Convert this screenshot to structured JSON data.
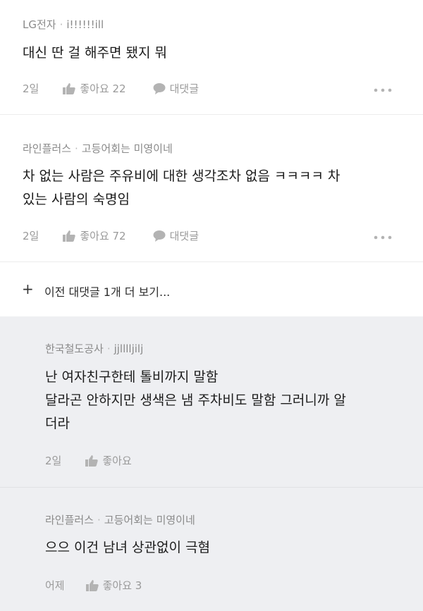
{
  "comments": [
    {
      "author": "LG전자",
      "nickname": "i!!!!!!ill",
      "text_lines": [
        "대신 딴 걸 해주면 됐지 뭐"
      ],
      "date": "2일",
      "like_label": "좋아요 22",
      "reply_label": "대댓글",
      "more_glyph": "•••"
    },
    {
      "author": "라인플러스",
      "nickname": "고등어회는 미영이네",
      "text_lines": [
        "차 없는 사람은 주유비에 대한 생각조차 없음 ㅋㅋㅋㅋ 차",
        "있는 사람의 숙명임"
      ],
      "date": "2일",
      "like_label": "좋아요 72",
      "reply_label": "대댓글",
      "more_glyph": "•••"
    }
  ],
  "more_replies": {
    "plus": "+",
    "label": "이전 대댓글 1개 더 보기..."
  },
  "replies": [
    {
      "author": "한국철도공사",
      "nickname": "jjlllljilj",
      "text_lines": [
        "난 여자친구한테 톨비까지 말함",
        "달라곤 안하지만 생색은 냄 주차비도 말함 그러니까 알",
        "더라"
      ],
      "date": "2일",
      "like_label": "좋아요"
    },
    {
      "author": "라인플러스",
      "nickname": "고등어회는 미영이네",
      "text_lines": [
        "으으 이건 남녀 상관없이 극혐"
      ],
      "date": "어제",
      "like_label": "좋아요 3"
    }
  ],
  "colors": {
    "reply_bg": "#eeeff2",
    "meta_text": "#8a8a8a",
    "icon": "#b3b3b3"
  },
  "icons": {
    "like": "thumbs-up-icon",
    "reply": "speech-bubble-icon",
    "more": "more-dots-icon"
  }
}
